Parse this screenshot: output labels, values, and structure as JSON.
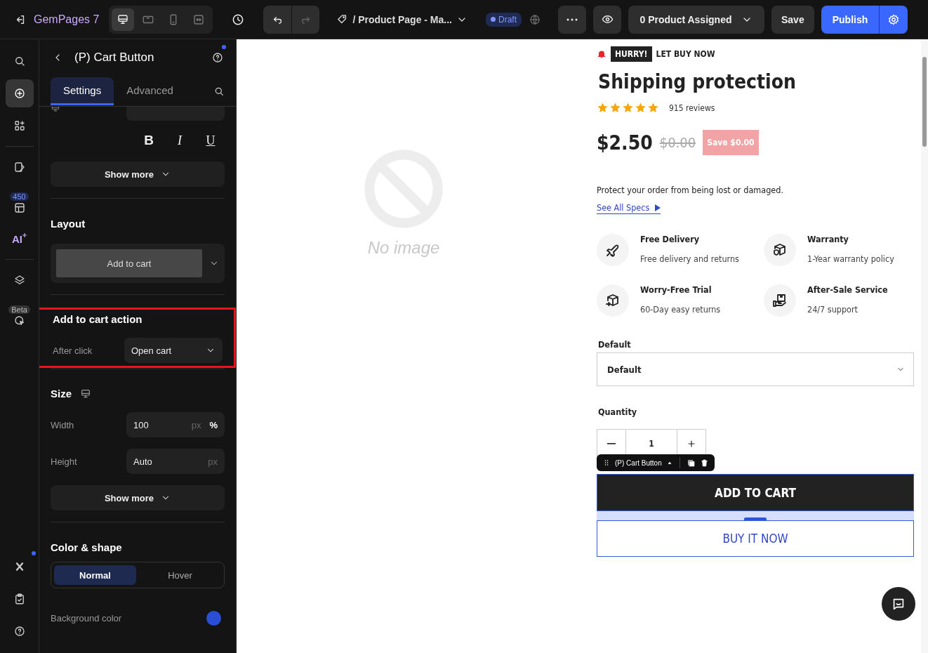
{
  "topbar": {
    "logo": "GemPages 7",
    "devices": [
      {
        "kind": "desktop",
        "selected": true
      },
      {
        "kind": "tablet",
        "selected": false
      },
      {
        "kind": "mobile",
        "selected": false
      },
      {
        "kind": "fit",
        "selected": false
      }
    ],
    "page_title": "/ Product Page - Ma...",
    "status": "Draft",
    "assigned": "0 Product Assigned",
    "save": "Save",
    "publish": "Publish"
  },
  "rail": {
    "items": [
      {
        "kind": "search",
        "selected": false
      },
      {
        "kind": "add",
        "selected": true
      },
      {
        "kind": "apps",
        "selected": false
      },
      {
        "kind": "divider"
      },
      {
        "kind": "pages",
        "selected": false
      },
      {
        "kind": "templates",
        "selected": false,
        "badge": "450"
      },
      {
        "kind": "ai",
        "selected": false,
        "label": "AI"
      },
      {
        "kind": "divider"
      },
      {
        "kind": "layers",
        "selected": false
      },
      {
        "kind": "interaction",
        "selected": false,
        "badge": "Beta"
      }
    ],
    "bottom": [
      {
        "kind": "x"
      },
      {
        "kind": "clipboard"
      },
      {
        "kind": "help"
      }
    ]
  },
  "panel": {
    "title": "(P) Cart Button",
    "tabs": [
      {
        "label": "Settings",
        "selected": true
      },
      {
        "label": "Advanced",
        "selected": false
      }
    ],
    "typography": {
      "formats": [
        "B",
        "I",
        "U"
      ],
      "show_more": "Show more"
    },
    "layout": {
      "title": "Layout",
      "option": "Add to cart"
    },
    "action": {
      "title": "Add to cart action",
      "highlighted": true,
      "label": "After click",
      "value": "Open cart"
    },
    "size": {
      "title": "Size",
      "fields": [
        {
          "label": "Width",
          "value": "100",
          "units": [
            {
              "label": "px",
              "selected": false
            },
            {
              "label": "%",
              "selected": true
            }
          ]
        },
        {
          "label": "Height",
          "value": "Auto",
          "units": [
            {
              "label": "px",
              "selected": false
            }
          ]
        }
      ],
      "show_more": "Show more"
    },
    "color_shape": {
      "title": "Color & shape",
      "states": [
        {
          "label": "Normal",
          "selected": true
        },
        {
          "label": "Hover",
          "selected": false
        }
      ],
      "background_label": "Background color"
    }
  },
  "canvas": {
    "placeholder": "No image",
    "product": {
      "urgency_badge": "HURRY!",
      "urgency_text": "LET BUY NOW",
      "title": "Shipping protection",
      "stars": 5,
      "reviews": "915 reviews",
      "price": "$2.50",
      "compare_price": "$0.00",
      "save": "Save $0.00",
      "description": "Protect your order from being lost or damaged.",
      "specs_link": "See All Specs",
      "features": [
        {
          "kind": "plane",
          "title": "Free Delivery",
          "text": "Free delivery and returns"
        },
        {
          "kind": "warranty",
          "title": "Warranty",
          "text": "1-Year warranty policy"
        },
        {
          "kind": "return",
          "title": "Worry-Free Trial",
          "text": "60-Day easy returns"
        },
        {
          "kind": "support",
          "title": "After-Sale Service",
          "text": "24/7 support"
        }
      ],
      "variant_label": "Default",
      "variant_value": "Default",
      "quantity_label": "Quantity",
      "quantity": "1",
      "element_toolbar": "(P) Cart Button",
      "add_to_cart": "ADD TO CART",
      "buy_now": "BUY IT NOW"
    }
  }
}
